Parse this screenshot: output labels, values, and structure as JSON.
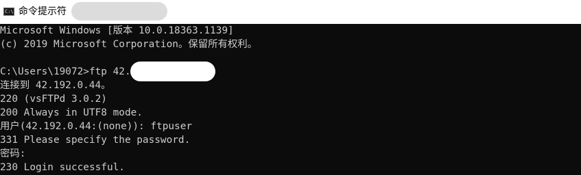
{
  "window": {
    "title": "命令提示符",
    "icon": "console-icon",
    "icon_glyph": "C:\\"
  },
  "console": {
    "lines": [
      "Microsoft Windows [版本 10.0.18363.1139]",
      "(c) 2019 Microsoft Corporation。保留所有权利。",
      "",
      "C:\\Users\\19072>ftp 42.",
      "连接到 42.192.0.44。",
      "220 (vsFTPd 3.0.2)",
      "200 Always in UTF8 mode.",
      "用户(42.192.0.44:(none)): ftpuser",
      "331 Please specify the password.",
      "密码:",
      "230 Login successful."
    ]
  },
  "colors": {
    "console_background": "#0c0c0c",
    "console_text": "#cccccc",
    "titlebar_background": "#ffffff"
  }
}
